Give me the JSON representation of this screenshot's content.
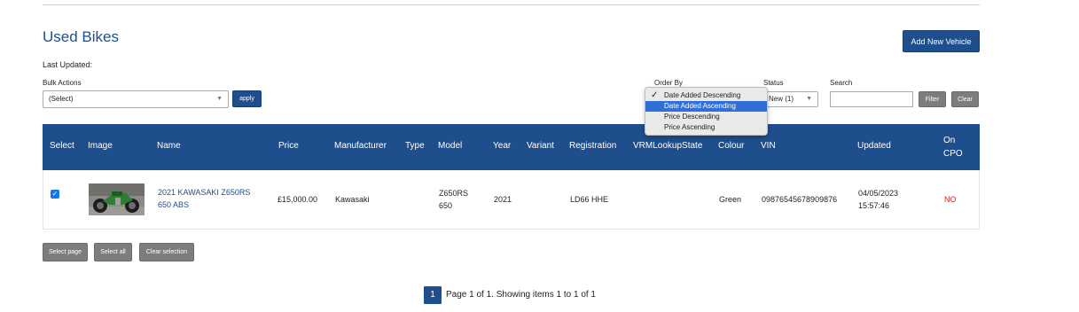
{
  "page": {
    "title": "Used Bikes",
    "last_updated_label": "Last Updated:"
  },
  "header": {
    "add_button": "Add New Vehicle"
  },
  "bulk": {
    "label": "Bulk Actions",
    "selected": "(Select)",
    "apply": "apply"
  },
  "order": {
    "label": "Order By",
    "options": [
      "Date Added Descending",
      "Date Added Ascending",
      "Price Descending",
      "Price Ascending"
    ],
    "checked_option": "Date Added Descending",
    "highlighted_option": "Date Added Ascending"
  },
  "status": {
    "label": "Status",
    "selected": "New (1)"
  },
  "search": {
    "label": "Search",
    "value": "",
    "filter": "Filter",
    "clear": "Clear"
  },
  "table": {
    "headers": [
      "Select",
      "Image",
      "Name",
      "Price",
      "Manufacturer",
      "Type",
      "Model",
      "Year",
      "Variant",
      "Registration",
      "VRMLookupState",
      "Colour",
      "VIN",
      "Updated",
      "On CPO"
    ],
    "rows": [
      {
        "name_line1": "2021 KAWASAKI Z650RS",
        "name_line2": "650 ABS",
        "price": "£15,000.00",
        "manufacturer": "Kawasaki",
        "type": "",
        "model_line1": "Z650RS",
        "model_line2": "650",
        "year": "2021",
        "variant": "",
        "registration": "LD66 HHE",
        "vrm_state": "",
        "colour": "Green",
        "vin": "09876545678909876",
        "updated_line1": "04/05/2023",
        "updated_line2": "15:57:46",
        "on_cpo": "NO",
        "selected": true
      }
    ]
  },
  "selection": {
    "select_page": "Select page",
    "select_all": "Select all",
    "clear_selection": "Clear selection"
  },
  "pager": {
    "current": "1",
    "summary": "Page 1 of 1. Showing items 1 to 1 of 1"
  },
  "colors": {
    "brand": "#1f4e8c",
    "grey_button": "#7d7d7d",
    "no_text": "#e0231c",
    "highlight": "#2f6fd6"
  }
}
